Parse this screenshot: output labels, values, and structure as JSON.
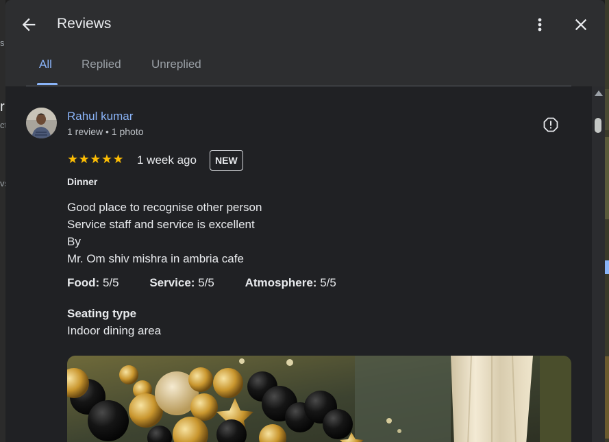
{
  "dialog": {
    "title": "Reviews",
    "tabs": [
      {
        "label": "All",
        "active": true
      },
      {
        "label": "Replied",
        "active": false
      },
      {
        "label": "Unreplied",
        "active": false
      }
    ]
  },
  "background_fragments": [
    "s",
    "r",
    "ct",
    "vs"
  ],
  "review": {
    "author": "Rahul kumar",
    "author_meta": "1 review • 1 photo",
    "rating": 5,
    "stars": "★★★★★",
    "time": "1 week ago",
    "badge": "NEW",
    "meal_type": "Dinner",
    "text_lines": [
      "Good place to recognise other person",
      "Service staff and service is excellent",
      "By",
      "Mr. Om shiv mishra in ambria cafe"
    ],
    "ratings": [
      {
        "label": "Food:",
        "value": "5/5"
      },
      {
        "label": "Service:",
        "value": "5/5"
      },
      {
        "label": "Atmosphere:",
        "value": "5/5"
      }
    ],
    "seating_label": "Seating type",
    "seating_value": "Indoor dining area"
  },
  "icons": {
    "back": "arrow-back-icon",
    "more": "more-vert-icon",
    "close": "close-icon",
    "flag": "report-icon"
  },
  "colors": {
    "accent": "#8ab4f8",
    "star": "#fbbc04",
    "background": "#202124",
    "header": "#2d2e30"
  }
}
